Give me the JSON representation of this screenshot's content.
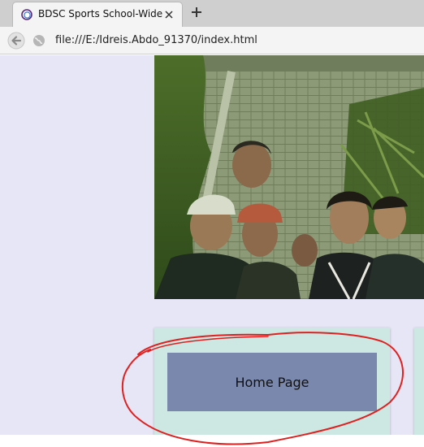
{
  "browser": {
    "tab_title": "BDSC Sports School-Wide",
    "url": "file:///E:/Idreis.Abdo_91370/index.html",
    "icons": {
      "favicon": "browser-favicon",
      "close": "close-icon",
      "new_tab": "plus-icon",
      "back": "back-arrow-icon",
      "site_info": "globe-icon"
    }
  },
  "page": {
    "background_color": "#e6e6f6",
    "hero_image": "photo of students gathered outdoors in front of a tiled roof",
    "nav_card": {
      "background_color": "#cde8e2",
      "home_button_label": "Home Page",
      "home_button_color": "#7b88ad"
    },
    "annotation": {
      "shape": "hand-drawn red circle around the Home Page button",
      "color": "#e02020"
    }
  }
}
